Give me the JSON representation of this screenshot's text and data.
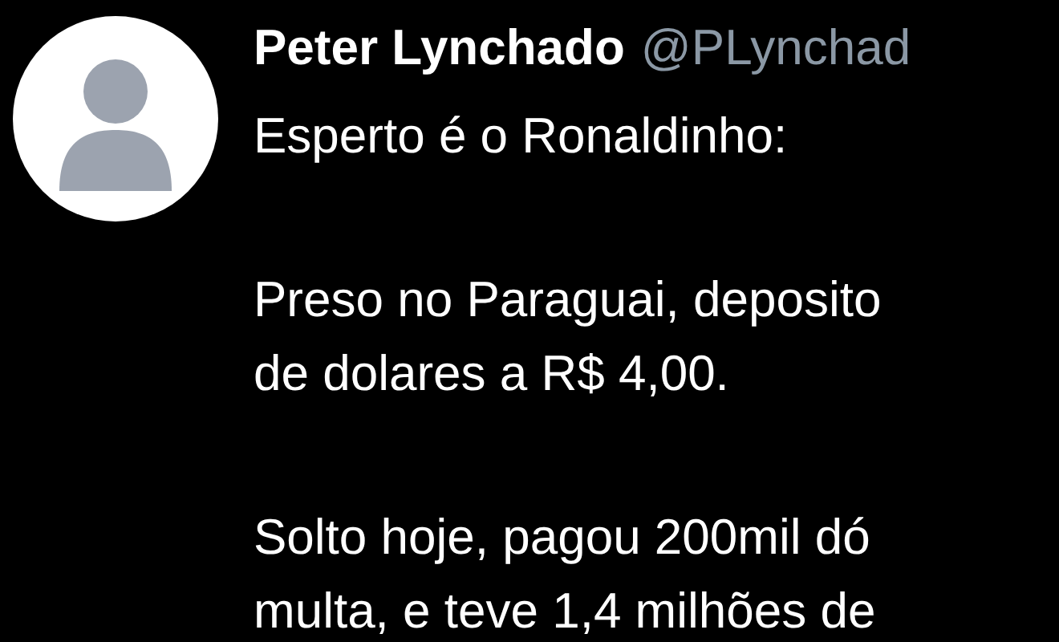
{
  "tweet": {
    "author": {
      "name": "Peter Lynchado",
      "handle": "@PLynchad"
    },
    "paragraphs": [
      [
        "Esperto é o Ronaldinho:"
      ],
      [
        "Preso no Paraguai, deposito",
        "de dolares a R$ 4,00."
      ],
      [
        "Solto hoje, pagou 200mil dó",
        "multa, e teve 1,4 milhões de"
      ]
    ]
  }
}
